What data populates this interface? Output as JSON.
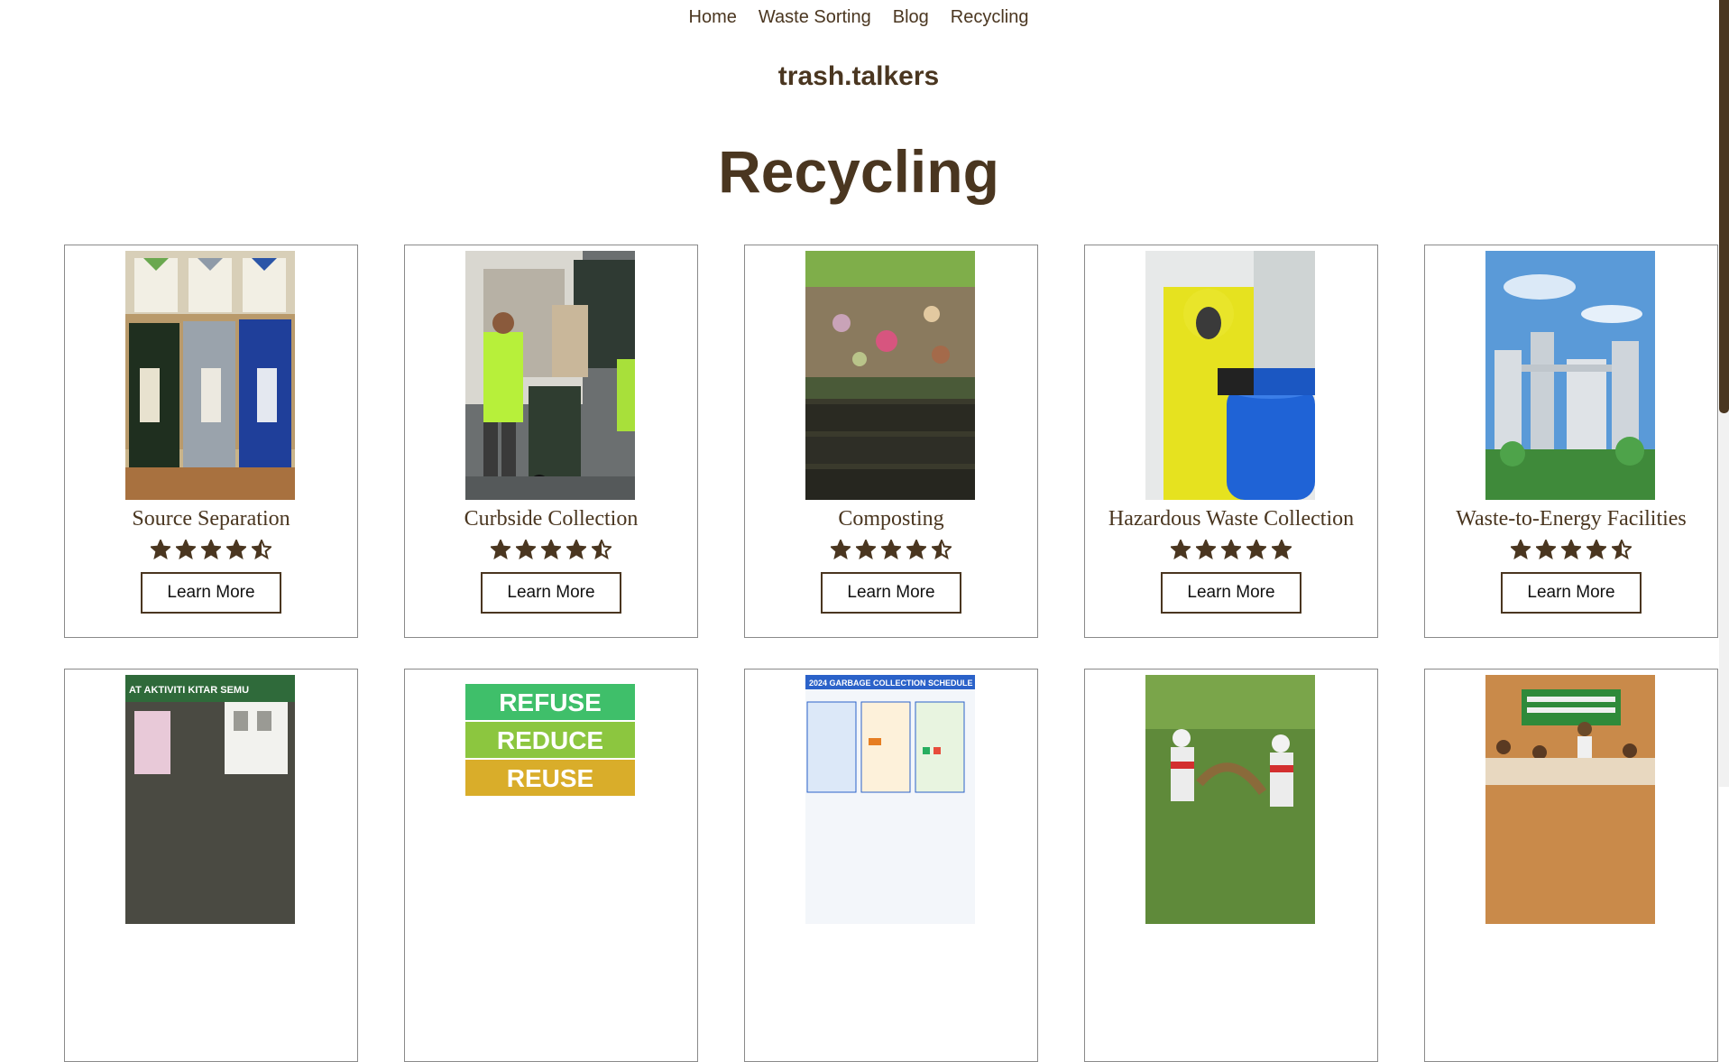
{
  "nav": {
    "items": [
      {
        "label": "Home"
      },
      {
        "label": "Waste Sorting"
      },
      {
        "label": "Blog"
      },
      {
        "label": "Recycling"
      }
    ]
  },
  "brand": {
    "name": "trash.talkers"
  },
  "page": {
    "title": "Recycling"
  },
  "colors": {
    "accent": "#4a3620",
    "background": "#ffffff"
  },
  "cards": [
    {
      "title": "Source Separation",
      "rating": 4.5,
      "button_label": "Learn More",
      "image_icon": "recycling-bins-photo"
    },
    {
      "title": "Curbside Collection",
      "rating": 4.5,
      "button_label": "Learn More",
      "image_icon": "garbage-truck-photo"
    },
    {
      "title": "Composting",
      "rating": 4.5,
      "button_label": "Learn More",
      "image_icon": "compost-bin-photo"
    },
    {
      "title": "Hazardous Waste Collection",
      "rating": 5,
      "button_label": "Learn More",
      "image_icon": "hazmat-worker-photo"
    },
    {
      "title": "Waste-to-Energy Facilities",
      "rating": 4.5,
      "button_label": "Learn More",
      "image_icon": "power-plant-photo"
    },
    {
      "title": "",
      "image_icon": "recycling-center-photo",
      "image_text": "AT AKTIVITI KITAR SEMU"
    },
    {
      "title": "",
      "image_icon": "refuse-reduce-reuse-poster",
      "image_text": [
        "REFUSE",
        "REDUCE",
        "REUSE"
      ]
    },
    {
      "title": "",
      "image_icon": "garbage-schedule-infographic",
      "image_text": "2024 GARBAGE COLLECTION SCHEDULE"
    },
    {
      "title": "",
      "image_icon": "volunteers-cleanup-photo"
    },
    {
      "title": "",
      "image_icon": "community-meeting-photo"
    }
  ]
}
